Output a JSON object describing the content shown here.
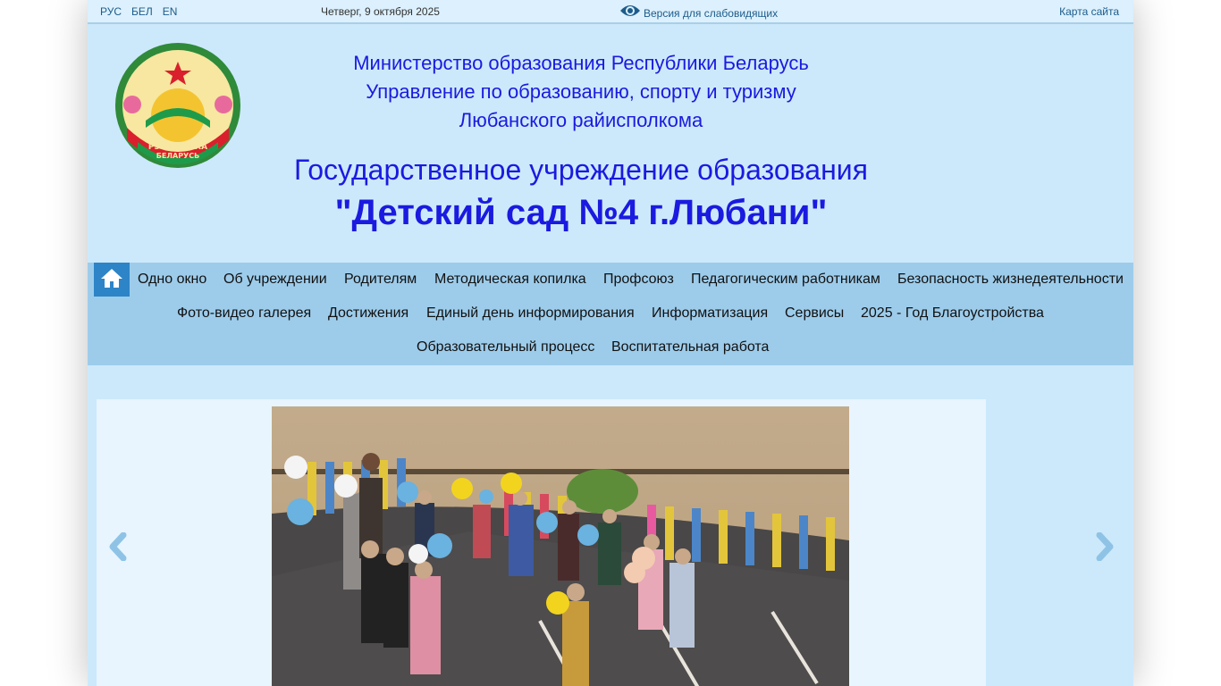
{
  "topbar": {
    "lang": [
      "РУС",
      "БЕЛ",
      "EN"
    ],
    "date": "Четверг, 9 октября 2025",
    "vision_label": "Версия для слабовидящих",
    "sitemap_label": "Карта сайта"
  },
  "header": {
    "line1": "Министерство образования Республики Беларусь",
    "line2": "Управление по образованию, спорту и туризму",
    "line3": "Любанского райисполкома",
    "line4": "Государственное учреждение образования",
    "line5": "\"Детский сад №4 г.Любани\"",
    "emblem_text_top": "РЭСПУБЛІКА",
    "emblem_text_bottom": "БЕЛАРУСЬ"
  },
  "nav": {
    "row1": [
      "Одно окно",
      "Об учреждении",
      "Родителям",
      "Методическая копилка",
      "Профсоюз",
      "Педагогическим работникам",
      "Безопасность жизнедеятельности"
    ],
    "row2": [
      "Фото-видео галерея",
      "Достижения",
      "Единый день информирования",
      "Информатизация",
      "Сервисы",
      "2025 - Год Благоустройства"
    ],
    "row3": [
      "Образовательный процесс",
      "Воспитательная работа"
    ]
  },
  "colors": {
    "header_text": "#1a1ae0",
    "page_bg": "#cce9fb",
    "nav_bg": "#9dcceb",
    "home_button": "#2d84c7",
    "arrow": "#8fc3e6"
  },
  "icons": {
    "home": "home-icon",
    "vision": "eye-icon",
    "prev": "chevron-left-icon",
    "next": "chevron-right-icon"
  }
}
